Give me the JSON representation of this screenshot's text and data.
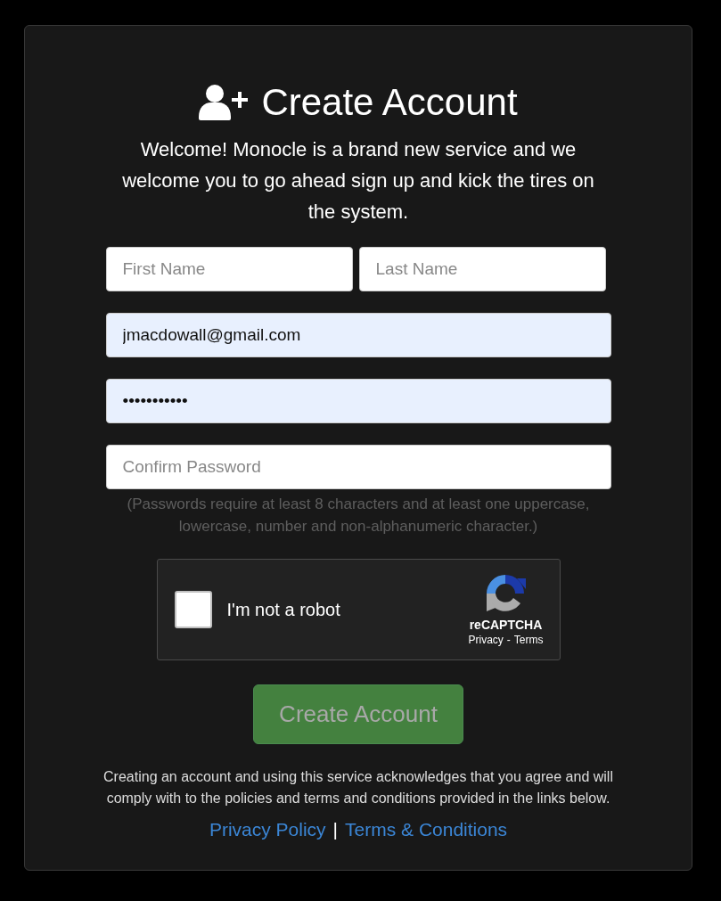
{
  "title": "Create Account",
  "intro": "Welcome! Monocle is a brand new service and we welcome you to go ahead sign up and kick the tires on the system.",
  "name_fields": [
    {
      "placeholder": "First Name"
    },
    {
      "placeholder": "Last Name"
    }
  ],
  "fields": [
    {
      "kind": "text",
      "value": "jmacdowall@gmail.com",
      "autofilled": true
    },
    {
      "kind": "text",
      "value": "•••••••••••",
      "autofilled": true
    },
    {
      "kind": "text",
      "placeholder": "Confirm Password",
      "autofilled": false
    }
  ],
  "password_hint": "(Passwords require at least 8 characters and at least one uppercase, lowercase, number and non-alphanumeric character.)",
  "captcha": {
    "label": "I'm not a robot",
    "checked": false,
    "brand": "reCAPTCHA",
    "privacy": "Privacy",
    "separator": "-",
    "terms": "Terms"
  },
  "submit": {
    "label": "Create Account",
    "disabled": true
  },
  "notice": "Creating an account and using this service acknowledges that you agree and will comply with to the policies and terms and conditions provided in the links below.",
  "links": [
    {
      "label": "Privacy Policy"
    },
    {
      "label": "Terms & Conditions"
    }
  ],
  "link_separator": "|"
}
